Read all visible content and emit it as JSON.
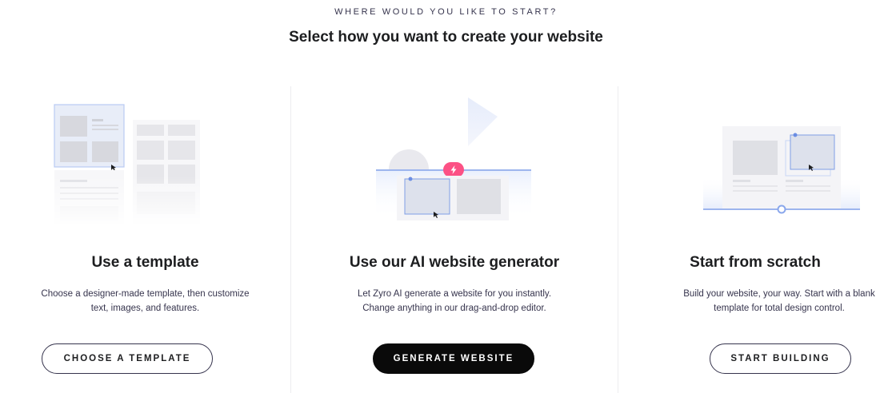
{
  "header": {
    "eyebrow": "WHERE WOULD YOU LIKE TO START?",
    "title": "Select how you want to create your website"
  },
  "options": [
    {
      "title": "Use a template",
      "description_lines": [
        "Choose a designer-made template, then customize",
        "text, images, and features."
      ],
      "button_label": "CHOOSE A TEMPLATE",
      "button_style": "outline"
    },
    {
      "title": "Use our AI website generator",
      "description_lines": [
        "Let Zyro AI generate a website for you instantly.",
        "Change anything in our drag-and-drop editor."
      ],
      "button_label": "GENERATE WEBSITE",
      "button_style": "solid"
    },
    {
      "title": "Start from scratch",
      "description_lines": [
        "Build your website, your way. Start with a blank",
        "template for total design control."
      ],
      "button_label": "START BUILDING",
      "button_style": "outline"
    }
  ],
  "colors": {
    "accent_blue": "#6b8de3",
    "ai_badge": "#fc5185",
    "text_dark": "#1d1e20",
    "button_dark": "#0a0a0a"
  },
  "icons": {
    "ai_badge": "lightning-icon"
  }
}
